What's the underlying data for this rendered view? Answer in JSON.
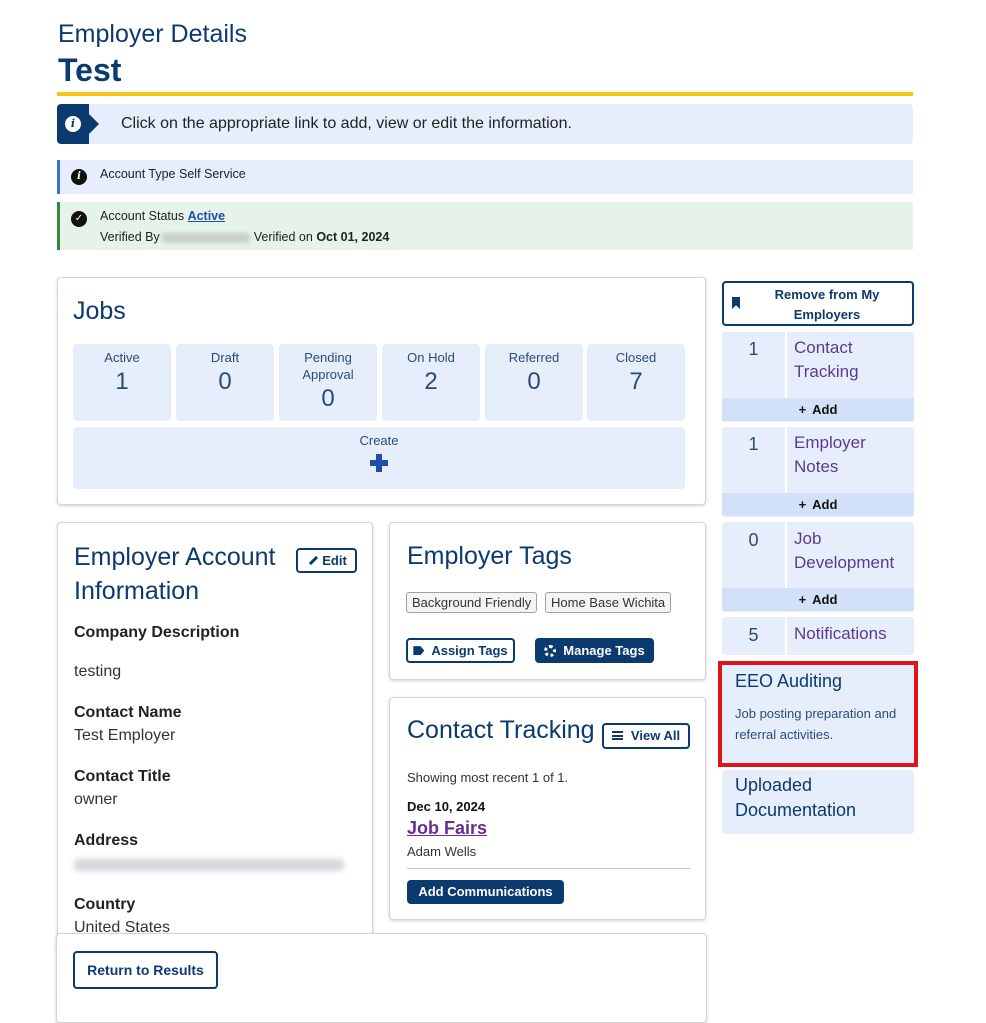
{
  "header": {
    "subtitle": "Employer Details",
    "title": "Test"
  },
  "banner": {
    "icon": "info-icon",
    "text": "Click on the appropriate link to add, view or edit the information."
  },
  "account_type": {
    "label": "Account Type",
    "value": "Self Service"
  },
  "account_status": {
    "label": "Account Status",
    "value": "Active",
    "verified_by_label": "Verified By",
    "verified_on_label": "Verified on",
    "verified_on_date": "Oct 01, 2024"
  },
  "jobs": {
    "title": "Jobs",
    "stats": [
      {
        "label": "Active",
        "value": "1"
      },
      {
        "label": "Draft",
        "value": "0"
      },
      {
        "label": "Pending Approval",
        "value": "0"
      },
      {
        "label": "On Hold",
        "value": "2"
      },
      {
        "label": "Referred",
        "value": "0"
      },
      {
        "label": "Closed",
        "value": "7"
      }
    ],
    "create_label": "Create"
  },
  "account_info": {
    "title": "Employer Account Information",
    "edit_label": "Edit",
    "company_description_label": "Company Description",
    "company_description": "testing",
    "contact_name_label": "Contact Name",
    "contact_name": "Test Employer",
    "contact_title_label": "Contact Title",
    "contact_title": "owner",
    "address_label": "Address",
    "country_label": "Country",
    "country": "United States"
  },
  "tags": {
    "title": "Employer Tags",
    "items": [
      "Background Friendly",
      "Home Base Wichita"
    ],
    "assign_label": "Assign Tags",
    "manage_label": "Manage Tags"
  },
  "contact_tracking": {
    "title": "Contact Tracking",
    "view_all_label": "View All",
    "showing": "Showing most recent 1 of 1.",
    "date": "Dec 10, 2024",
    "entry": "Job Fairs",
    "person": "Adam Wells",
    "add_label": "Add Communications"
  },
  "footer": {
    "return_label": "Return to Results"
  },
  "sidebar": {
    "remove_label": "Remove from My Employers",
    "items": [
      {
        "count": "1",
        "label": "Contact Tracking",
        "add": "Add"
      },
      {
        "count": "1",
        "label": "Employer Notes",
        "add": "Add"
      },
      {
        "count": "0",
        "label": "Job Development",
        "add": "Add"
      },
      {
        "count": "5",
        "label": "Notifications"
      }
    ],
    "eeo": {
      "title": "EEO Auditing",
      "description": "Job posting preparation and referral activities."
    },
    "uploaded": "Uploaded Documentation"
  },
  "colors": {
    "brand_navy": "#0b3a6f",
    "accent_gold": "#f5c518",
    "highlight_red": "#e0131b",
    "link_purple": "#6a2d91"
  }
}
